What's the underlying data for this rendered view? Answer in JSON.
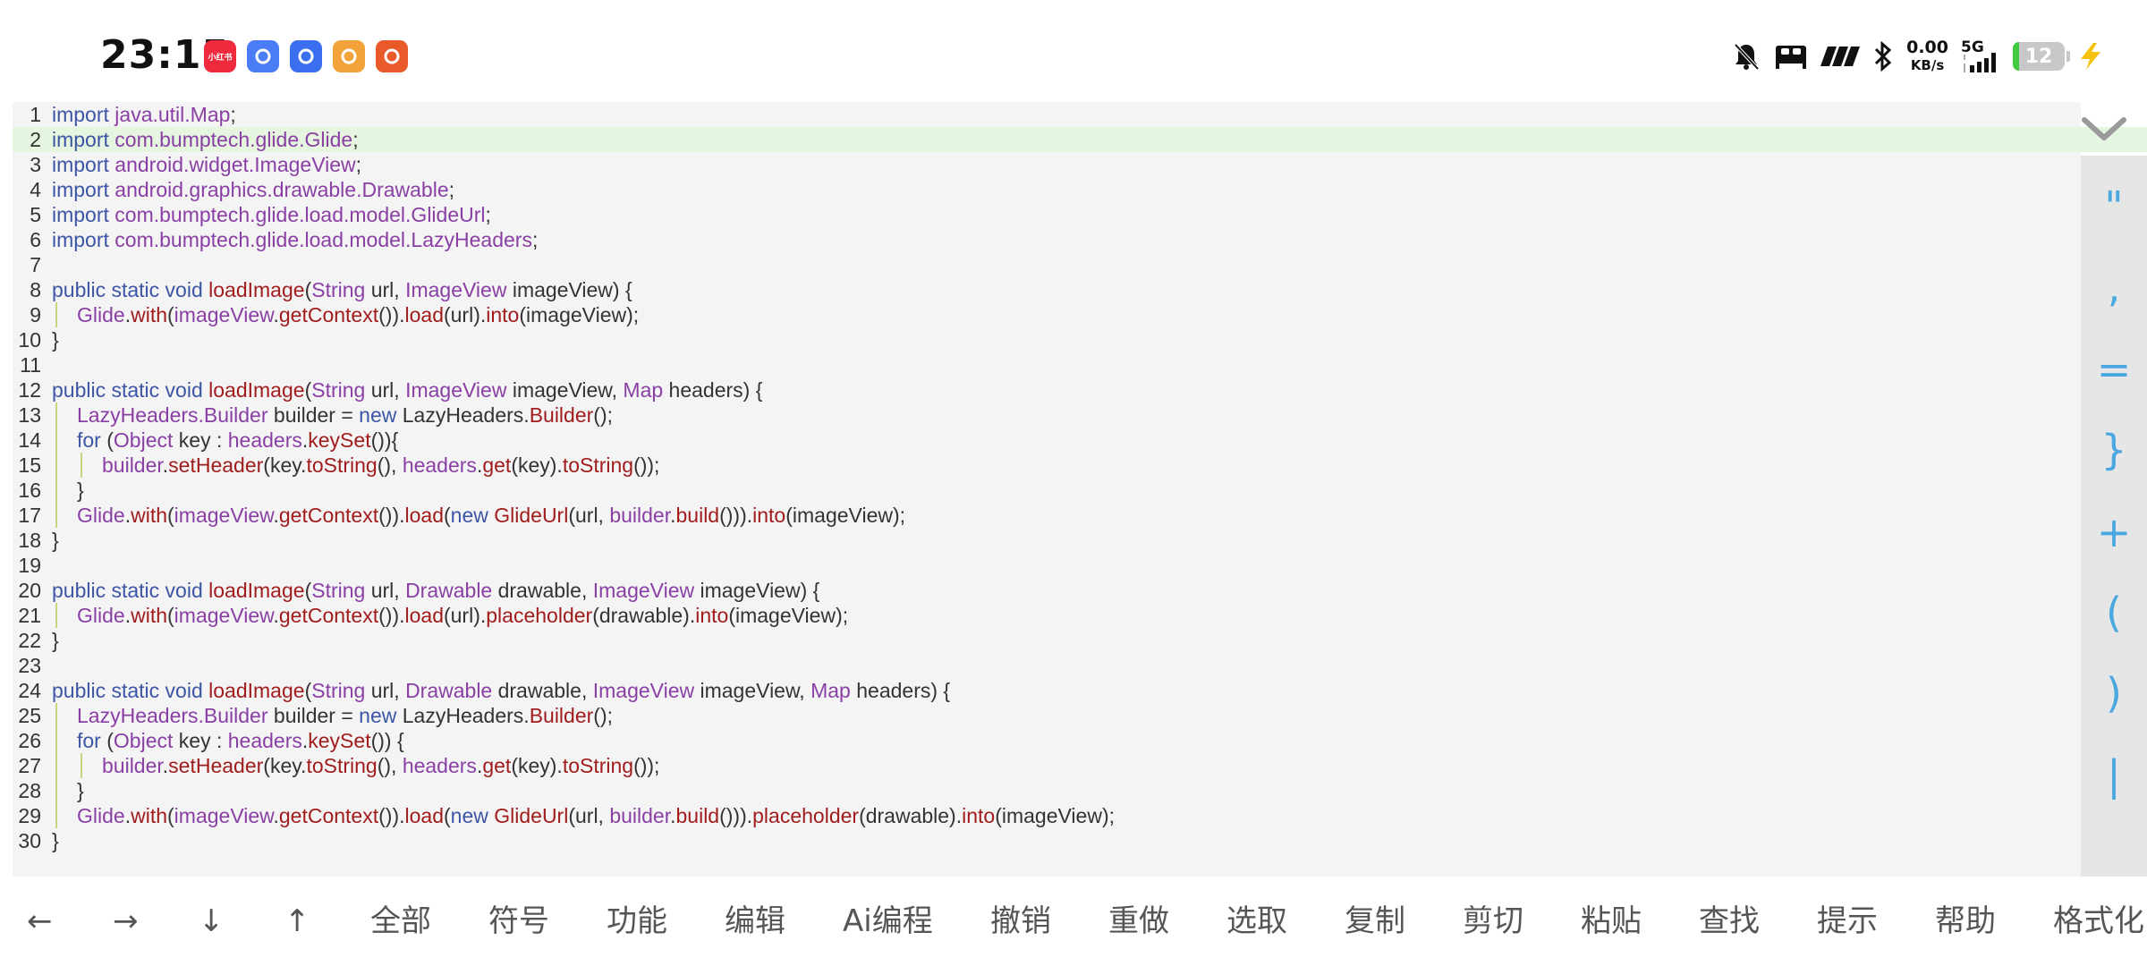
{
  "status_bar": {
    "time": "23:15",
    "apps": [
      {
        "icon": "xiaohongshu-icon",
        "label": "小红书",
        "color": "#ee2a3c"
      },
      {
        "icon": "browser-icon",
        "label": "",
        "color": "#4a7cf5"
      },
      {
        "icon": "star-app-icon",
        "label": "",
        "color": "#3b6ff0"
      },
      {
        "icon": "video-app-icon",
        "label": "",
        "color": "#f2a43a"
      },
      {
        "icon": "game-app-icon",
        "label": "",
        "color": "#e85a2a"
      }
    ],
    "net_speed_value": "0.00",
    "net_speed_unit": "KB/s",
    "network_type": "5G",
    "battery_level": "12",
    "battery_fraction": 0.12
  },
  "editor": {
    "highlighted_line": 2,
    "lines": [
      {
        "n": "1",
        "indent": 0,
        "tokens": [
          [
            "kw",
            "import "
          ],
          [
            "ty",
            "java.util.Map"
          ],
          [
            "tx",
            ";"
          ]
        ]
      },
      {
        "n": "2",
        "indent": 0,
        "tokens": [
          [
            "kw",
            "import "
          ],
          [
            "ty",
            "com.bumptech.glide.Glide"
          ],
          [
            "tx",
            ";"
          ]
        ]
      },
      {
        "n": "3",
        "indent": 0,
        "tokens": [
          [
            "kw",
            "import "
          ],
          [
            "ty",
            "android.widget.ImageView"
          ],
          [
            "tx",
            ";"
          ]
        ]
      },
      {
        "n": "4",
        "indent": 0,
        "tokens": [
          [
            "kw",
            "import "
          ],
          [
            "ty",
            "android.graphics.drawable.Drawable"
          ],
          [
            "tx",
            ";"
          ]
        ]
      },
      {
        "n": "5",
        "indent": 0,
        "tokens": [
          [
            "kw",
            "import "
          ],
          [
            "ty",
            "com.bumptech.glide.load.model.GlideUrl"
          ],
          [
            "tx",
            ";"
          ]
        ]
      },
      {
        "n": "6",
        "indent": 0,
        "tokens": [
          [
            "kw",
            "import "
          ],
          [
            "ty",
            "com.bumptech.glide.load.model.LazyHeaders"
          ],
          [
            "tx",
            ";"
          ]
        ]
      },
      {
        "n": "7",
        "indent": 0,
        "tokens": []
      },
      {
        "n": "8",
        "indent": 0,
        "tokens": [
          [
            "kw",
            "public static void "
          ],
          [
            "fn",
            "loadImage"
          ],
          [
            "tx",
            "("
          ],
          [
            "ty",
            "String"
          ],
          [
            "tx",
            " url, "
          ],
          [
            "ty",
            "ImageView"
          ],
          [
            "tx",
            " imageView) {"
          ]
        ]
      },
      {
        "n": "9",
        "indent": 1,
        "tokens": [
          [
            "ty",
            "Glide"
          ],
          [
            "tx",
            "."
          ],
          [
            "fn",
            "with"
          ],
          [
            "tx",
            "("
          ],
          [
            "ty",
            "imageView"
          ],
          [
            "tx",
            "."
          ],
          [
            "fn",
            "getContext"
          ],
          [
            "tx",
            "())."
          ],
          [
            "fn",
            "load"
          ],
          [
            "tx",
            "(url)."
          ],
          [
            "fn",
            "into"
          ],
          [
            "tx",
            "(imageView);"
          ]
        ]
      },
      {
        "n": "10",
        "indent": 0,
        "tokens": [
          [
            "tx",
            "}"
          ]
        ]
      },
      {
        "n": "11",
        "indent": 0,
        "tokens": []
      },
      {
        "n": "12",
        "indent": 0,
        "tokens": [
          [
            "kw",
            "public static void "
          ],
          [
            "fn",
            "loadImage"
          ],
          [
            "tx",
            "("
          ],
          [
            "ty",
            "String"
          ],
          [
            "tx",
            " url, "
          ],
          [
            "ty",
            "ImageView"
          ],
          [
            "tx",
            " imageView, "
          ],
          [
            "ty",
            "Map"
          ],
          [
            "tx",
            " headers) {"
          ]
        ]
      },
      {
        "n": "13",
        "indent": 1,
        "tokens": [
          [
            "ty",
            "LazyHeaders.Builder"
          ],
          [
            "tx",
            " builder = "
          ],
          [
            "kw",
            "new "
          ],
          [
            "tx",
            "LazyHeaders."
          ],
          [
            "fn",
            "Builder"
          ],
          [
            "tx",
            "();"
          ]
        ]
      },
      {
        "n": "14",
        "indent": 1,
        "tokens": [
          [
            "kw",
            "for "
          ],
          [
            "tx",
            "("
          ],
          [
            "ty",
            "Object"
          ],
          [
            "tx",
            " key : "
          ],
          [
            "ty",
            "headers"
          ],
          [
            "tx",
            "."
          ],
          [
            "fn",
            "keySet"
          ],
          [
            "tx",
            "()){"
          ]
        ]
      },
      {
        "n": "15",
        "indent": 2,
        "tokens": [
          [
            "ty",
            "builder"
          ],
          [
            "tx",
            "."
          ],
          [
            "fn",
            "setHeader"
          ],
          [
            "tx",
            "(key."
          ],
          [
            "fn",
            "toString"
          ],
          [
            "tx",
            "(), "
          ],
          [
            "ty",
            "headers"
          ],
          [
            "tx",
            "."
          ],
          [
            "fn",
            "get"
          ],
          [
            "tx",
            "(key)."
          ],
          [
            "fn",
            "toString"
          ],
          [
            "tx",
            "());"
          ]
        ]
      },
      {
        "n": "16",
        "indent": 1,
        "tokens": [
          [
            "tx",
            "}"
          ]
        ]
      },
      {
        "n": "17",
        "indent": 1,
        "tokens": [
          [
            "ty",
            "Glide"
          ],
          [
            "tx",
            "."
          ],
          [
            "fn",
            "with"
          ],
          [
            "tx",
            "("
          ],
          [
            "ty",
            "imageView"
          ],
          [
            "tx",
            "."
          ],
          [
            "fn",
            "getContext"
          ],
          [
            "tx",
            "())."
          ],
          [
            "fn",
            "load"
          ],
          [
            "tx",
            "("
          ],
          [
            "kw",
            "new "
          ],
          [
            "fn",
            "GlideUrl"
          ],
          [
            "tx",
            "(url, "
          ],
          [
            "ty",
            "builder"
          ],
          [
            "tx",
            "."
          ],
          [
            "fn",
            "build"
          ],
          [
            "tx",
            "()))."
          ],
          [
            "fn",
            "into"
          ],
          [
            "tx",
            "(imageView);"
          ]
        ]
      },
      {
        "n": "18",
        "indent": 0,
        "tokens": [
          [
            "tx",
            "}"
          ]
        ]
      },
      {
        "n": "19",
        "indent": 0,
        "tokens": []
      },
      {
        "n": "20",
        "indent": 0,
        "tokens": [
          [
            "kw",
            "public static void "
          ],
          [
            "fn",
            "loadImage"
          ],
          [
            "tx",
            "("
          ],
          [
            "ty",
            "String"
          ],
          [
            "tx",
            " url, "
          ],
          [
            "ty",
            "Drawable"
          ],
          [
            "tx",
            " drawable, "
          ],
          [
            "ty",
            "ImageView"
          ],
          [
            "tx",
            " imageView) {"
          ]
        ]
      },
      {
        "n": "21",
        "indent": 1,
        "tokens": [
          [
            "ty",
            "Glide"
          ],
          [
            "tx",
            "."
          ],
          [
            "fn",
            "with"
          ],
          [
            "tx",
            "("
          ],
          [
            "ty",
            "imageView"
          ],
          [
            "tx",
            "."
          ],
          [
            "fn",
            "getContext"
          ],
          [
            "tx",
            "())."
          ],
          [
            "fn",
            "load"
          ],
          [
            "tx",
            "(url)."
          ],
          [
            "fn",
            "placeholder"
          ],
          [
            "tx",
            "(drawable)."
          ],
          [
            "fn",
            "into"
          ],
          [
            "tx",
            "(imageView);"
          ]
        ]
      },
      {
        "n": "22",
        "indent": 0,
        "tokens": [
          [
            "tx",
            "}"
          ]
        ]
      },
      {
        "n": "23",
        "indent": 0,
        "tokens": []
      },
      {
        "n": "24",
        "indent": 0,
        "tokens": [
          [
            "kw",
            "public static void "
          ],
          [
            "fn",
            "loadImage"
          ],
          [
            "tx",
            "("
          ],
          [
            "ty",
            "String"
          ],
          [
            "tx",
            " url, "
          ],
          [
            "ty",
            "Drawable"
          ],
          [
            "tx",
            " drawable, "
          ],
          [
            "ty",
            "ImageView"
          ],
          [
            "tx",
            " imageView, "
          ],
          [
            "ty",
            "Map"
          ],
          [
            "tx",
            " headers) {"
          ]
        ]
      },
      {
        "n": "25",
        "indent": 1,
        "tokens": [
          [
            "ty",
            "LazyHeaders.Builder"
          ],
          [
            "tx",
            " builder = "
          ],
          [
            "kw",
            "new "
          ],
          [
            "tx",
            "LazyHeaders."
          ],
          [
            "fn",
            "Builder"
          ],
          [
            "tx",
            "();"
          ]
        ]
      },
      {
        "n": "26",
        "indent": 1,
        "tokens": [
          [
            "kw",
            "for "
          ],
          [
            "tx",
            "("
          ],
          [
            "ty",
            "Object"
          ],
          [
            "tx",
            " key : "
          ],
          [
            "ty",
            "headers"
          ],
          [
            "tx",
            "."
          ],
          [
            "fn",
            "keySet"
          ],
          [
            "tx",
            "()) {"
          ]
        ]
      },
      {
        "n": "27",
        "indent": 2,
        "tokens": [
          [
            "ty",
            "builder"
          ],
          [
            "tx",
            "."
          ],
          [
            "fn",
            "setHeader"
          ],
          [
            "tx",
            "(key."
          ],
          [
            "fn",
            "toString"
          ],
          [
            "tx",
            "(), "
          ],
          [
            "ty",
            "headers"
          ],
          [
            "tx",
            "."
          ],
          [
            "fn",
            "get"
          ],
          [
            "tx",
            "(key)."
          ],
          [
            "fn",
            "toString"
          ],
          [
            "tx",
            "());"
          ]
        ]
      },
      {
        "n": "28",
        "indent": 1,
        "tokens": [
          [
            "tx",
            "}"
          ]
        ]
      },
      {
        "n": "29",
        "indent": 1,
        "tokens": [
          [
            "ty",
            "Glide"
          ],
          [
            "tx",
            "."
          ],
          [
            "fn",
            "with"
          ],
          [
            "tx",
            "("
          ],
          [
            "ty",
            "imageView"
          ],
          [
            "tx",
            "."
          ],
          [
            "fn",
            "getContext"
          ],
          [
            "tx",
            "())."
          ],
          [
            "fn",
            "load"
          ],
          [
            "tx",
            "("
          ],
          [
            "kw",
            "new "
          ],
          [
            "fn",
            "GlideUrl"
          ],
          [
            "tx",
            "(url, "
          ],
          [
            "ty",
            "builder"
          ],
          [
            "tx",
            "."
          ],
          [
            "fn",
            "build"
          ],
          [
            "tx",
            "()))."
          ],
          [
            "fn",
            "placeholder"
          ],
          [
            "tx",
            "(drawable)."
          ],
          [
            "fn",
            "into"
          ],
          [
            "tx",
            "(imageView);"
          ]
        ]
      },
      {
        "n": "30",
        "indent": 0,
        "tokens": [
          [
            "tx",
            "}"
          ]
        ]
      }
    ]
  },
  "symbol_panel": {
    "symbols": [
      "\"",
      ",",
      "=",
      "}",
      "+",
      "(",
      ")",
      "|"
    ]
  },
  "toolbar": {
    "items": [
      "←",
      "→",
      "↓",
      "↑",
      "全部",
      "符号",
      "功能",
      "编辑",
      "Ai编程",
      "撤销",
      "重做",
      "选取",
      "复制",
      "剪切",
      "粘贴",
      "查找",
      "提示",
      "帮助",
      "格式化"
    ]
  },
  "colors": {
    "keyword": "#3c55a5",
    "type": "#8a3fa5",
    "function": "#a11c1c",
    "symbol_accent": "#4aa8e0",
    "highlight": "#e6f5df"
  }
}
